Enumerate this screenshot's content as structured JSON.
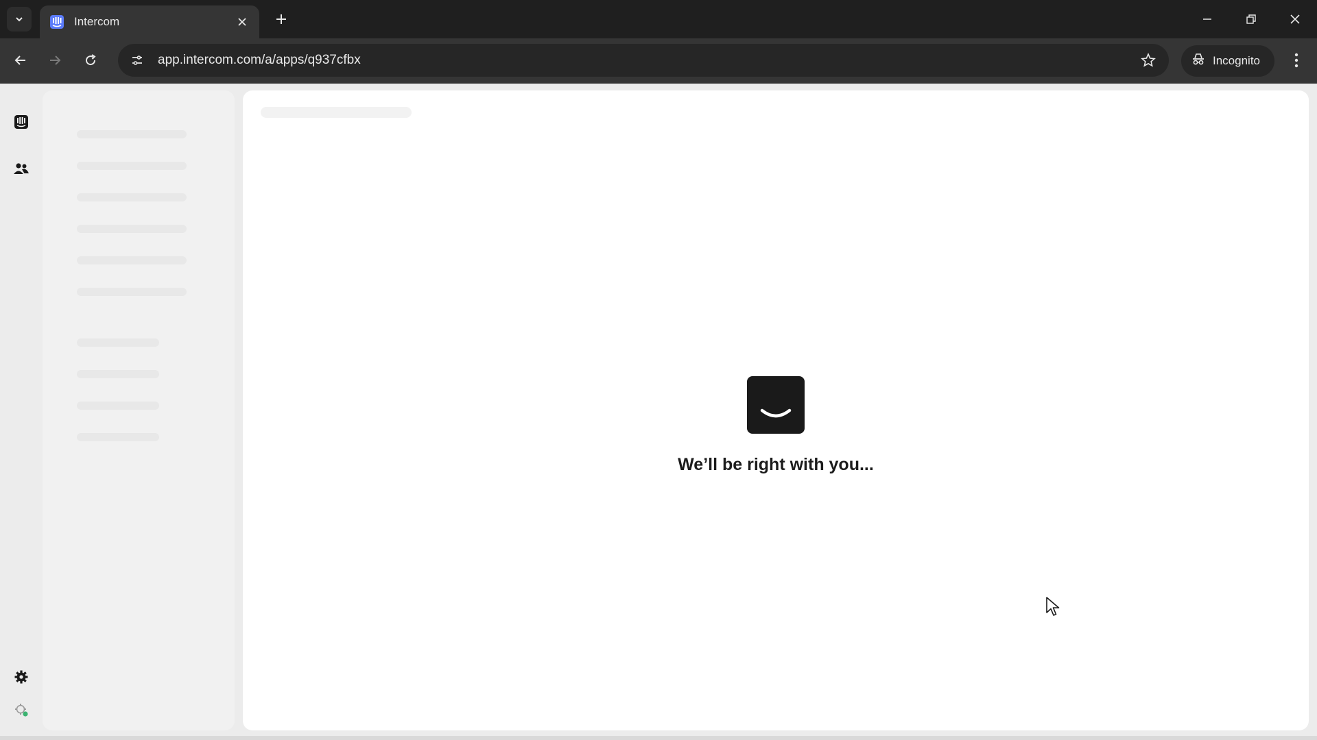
{
  "browser": {
    "tab_title": "Intercom",
    "url": "app.intercom.com/a/apps/q937cfbx",
    "incognito_label": "Incognito"
  },
  "main": {
    "loading_message": "We’ll be right with you..."
  },
  "colors": {
    "chrome_dark": "#1f1f1f",
    "toolbar": "#353535",
    "favicon_blue": "#5c7cfa",
    "logo_bg": "#1a1a1a",
    "status_dot_green": "#3cb371"
  },
  "icons": {
    "rail": [
      "inbox-icon",
      "contacts-icon",
      "settings-icon",
      "status-icon"
    ]
  }
}
